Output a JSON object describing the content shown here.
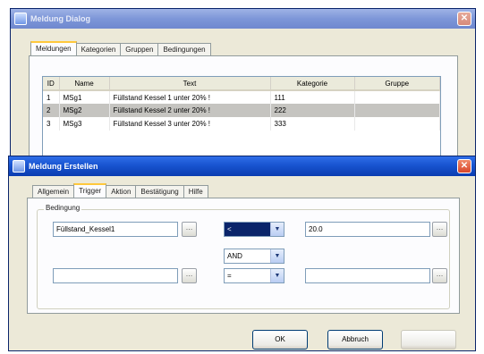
{
  "back_window": {
    "title": "Meldung Dialog",
    "tabs": [
      "Meldungen",
      "Kategorien",
      "Gruppen",
      "Bedingungen"
    ],
    "active_tab": 0,
    "columns": [
      "ID",
      "Name",
      "Text",
      "Kategorie",
      "Gruppe"
    ],
    "rows": [
      {
        "id": "1",
        "name": "MSg1",
        "text": "Füllstand Kessel 1 unter 20% !",
        "kategorie": "111",
        "gruppe": ""
      },
      {
        "id": "2",
        "name": "MSg2",
        "text": "Füllstand Kessel 2 unter 20% !",
        "kategorie": "222",
        "gruppe": ""
      },
      {
        "id": "3",
        "name": "MSg3",
        "text": "Füllstand Kessel 3 unter 20% !",
        "kategorie": "333",
        "gruppe": ""
      }
    ],
    "selected_row": 1
  },
  "front_window": {
    "title": "Meldung Erstellen",
    "tabs": [
      "Allgemein",
      "Trigger",
      "Aktion",
      "Bestätigung",
      "Hilfe"
    ],
    "active_tab": 1,
    "group_label": "Bedingung",
    "row1": {
      "left_value": "Füllstand_Kessel1",
      "operator": "<",
      "right_value": "20.0"
    },
    "logic": "AND",
    "row2": {
      "left_value": "",
      "operator": "=",
      "right_value": ""
    },
    "buttons": {
      "ok": "OK",
      "cancel": "Abbruch",
      "apply": ""
    }
  },
  "colors": {
    "title_active": "#1854d0",
    "title_inactive": "#7d96d8",
    "window_bg": "#ece9d8"
  }
}
